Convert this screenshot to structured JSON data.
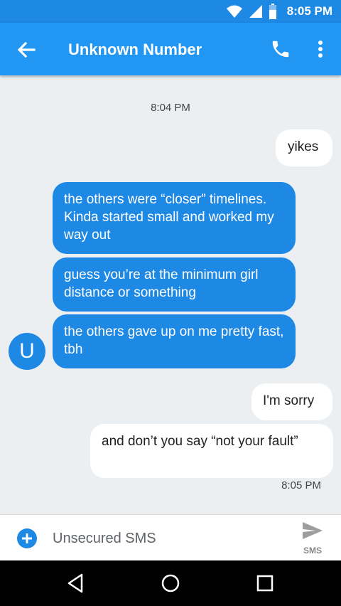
{
  "status_bar": {
    "time": "8:05 PM"
  },
  "header": {
    "title": "Unknown Number"
  },
  "conversation": {
    "timestamp_top": "8:04 PM",
    "timestamp_bottom": "8:05 PM",
    "avatar_letter": "U",
    "messages": [
      {
        "direction": "outgoing",
        "text": "yikes"
      },
      {
        "direction": "incoming",
        "text": "the others were “closer” timelines. Kinda started small and worked my way out"
      },
      {
        "direction": "incoming",
        "text": "guess you’re at the minimum girl distance or something"
      },
      {
        "direction": "incoming",
        "text": "the others gave up on me pretty fast, tbh"
      },
      {
        "direction": "outgoing",
        "text": "I'm sorry"
      },
      {
        "direction": "outgoing",
        "text": "and don’t you say “not your fault”"
      }
    ]
  },
  "compose": {
    "placeholder": "Unsecured SMS",
    "send_label": "SMS"
  },
  "colors": {
    "app_bar": "#2196f3",
    "status_bar": "#1e88e5",
    "incoming_bubble": "#1e88e5",
    "background": "#eceff1"
  }
}
